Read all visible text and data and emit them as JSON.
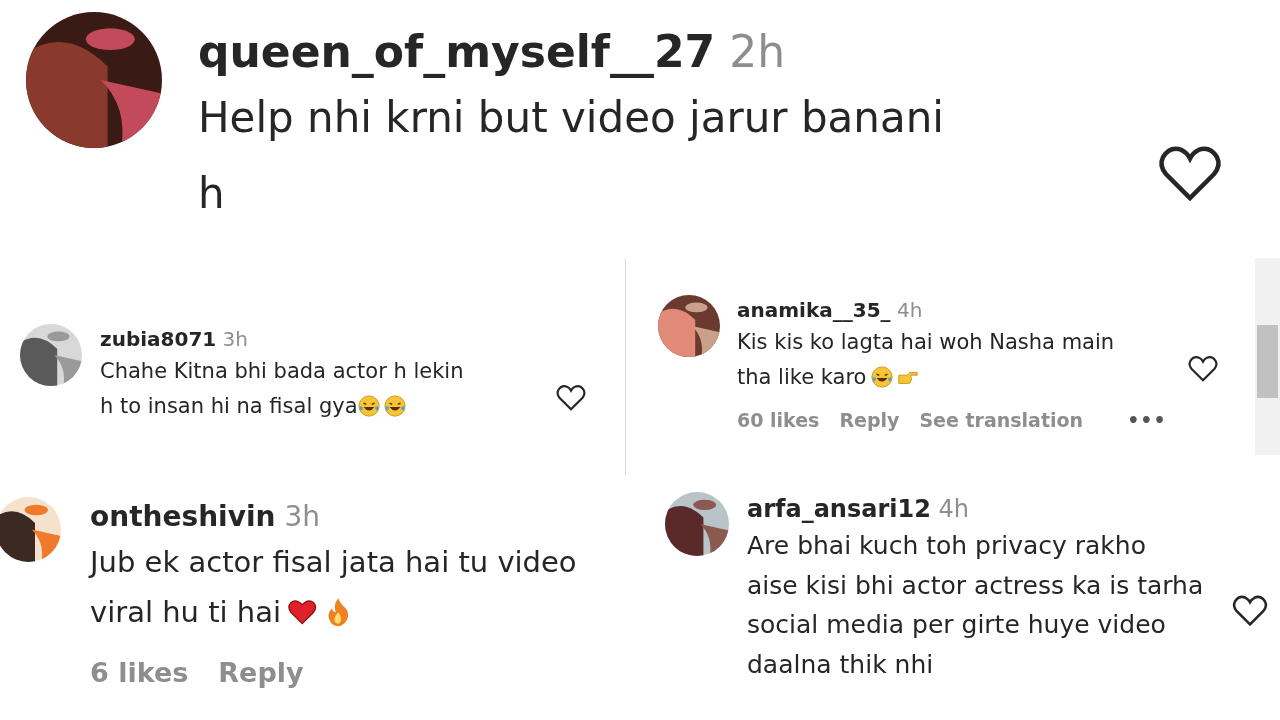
{
  "comments": [
    {
      "user": "queen_of_myself__27",
      "time": "2h",
      "lines": [
        "Help nhi krni but video jarur banani",
        "h"
      ],
      "liked": false
    },
    {
      "user": "zubia8071",
      "time": "3h",
      "lines": [
        "Chahe Kitna bhi bada actor h lekin",
        "h to insan hi na fisal gya"
      ],
      "emojis": [
        {
          "kind": "laughing"
        },
        {
          "kind": "laughing"
        }
      ],
      "liked": false
    },
    {
      "user": "anamika__35_",
      "time": "4h",
      "lines": [
        "Kis kis ko lagta hai woh Nasha main",
        "tha like karo"
      ],
      "emojis": [
        {
          "kind": "laughing"
        },
        {
          "kind": "pointing"
        }
      ],
      "liked": false,
      "actions": [
        {
          "kind": "likes",
          "label": "60 likes"
        },
        {
          "kind": "reply",
          "label": "Reply"
        },
        {
          "kind": "translation",
          "label": "See translation"
        },
        {
          "kind": "more",
          "label": "•••"
        }
      ]
    },
    {
      "user": "ontheshivin",
      "time": "3h",
      "lines": [
        "Jub ek actor fisal jata hai tu video",
        "viral hu ti hai"
      ],
      "emojis": [
        {
          "kind": "heart"
        },
        {
          "kind": "fire"
        }
      ],
      "actions": [
        {
          "kind": "likes",
          "label": "6 likes"
        },
        {
          "kind": "reply",
          "label": "Reply"
        }
      ]
    },
    {
      "user": "arfa_ansari12",
      "time": "4h",
      "lines": [
        "Are bhai kuch toh privacy rakho",
        "aise kisi bhi actor actress ka is tarha",
        "social media per girte huye video",
        "daalna thik nhi"
      ],
      "liked": false
    }
  ]
}
